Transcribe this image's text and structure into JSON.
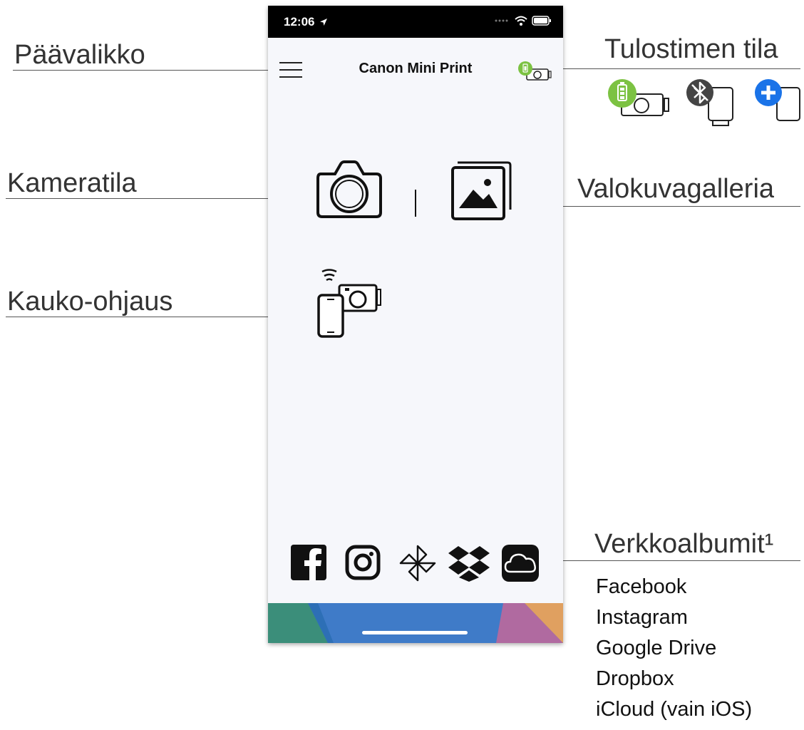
{
  "callouts": {
    "main_menu": "Päävalikko",
    "printer_status": "Tulostimen tila",
    "camera_mode": "Kameratila",
    "photo_gallery": "Valokuvagalleria",
    "remote_control": "Kauko-ohjaus",
    "online_albums": "Verkkoalbumit¹"
  },
  "phone": {
    "status_time": "12:06",
    "app_title": "Canon Mini Print"
  },
  "online_albums": [
    "Facebook",
    "Instagram",
    "Google Drive",
    "Dropbox",
    "iCloud (vain iOS)"
  ],
  "colors": {
    "battery_green": "#7cc242",
    "bluetooth_grey": "#444444",
    "add_blue": "#1a73e8",
    "screen_bg": "#f6f7fb"
  },
  "icons": {
    "menu": "hamburger-icon",
    "printer_status": "printer-battery-icon",
    "camera": "camera-icon",
    "gallery": "gallery-icon",
    "remote": "remote-control-icon",
    "albums": [
      "facebook-icon",
      "instagram-icon",
      "google-drive-icon",
      "dropbox-icon",
      "icloud-icon"
    ]
  }
}
